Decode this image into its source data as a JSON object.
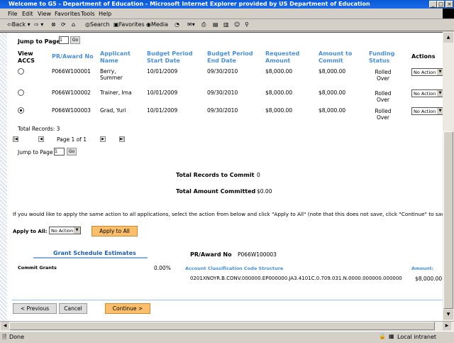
{
  "window": {
    "title": "Welcome to G5 - Department of Education - Microsoft Internet Explorer provided by US Department of Education"
  },
  "menu": [
    "File",
    "Edit",
    "View",
    "Favorites",
    "Tools",
    "Help"
  ],
  "toolbar": {
    "back": "Back",
    "search": "Search",
    "favorites": "Favorites",
    "media": "Media"
  },
  "jump_top": {
    "label": "Jump to Page",
    "value": "1",
    "go": "Go"
  },
  "table": {
    "headers": [
      "View ACCS",
      "PR/Award No",
      "Applicant Name",
      "Budget Period Start Date",
      "Budget Period End Date",
      "Requested Amount",
      "Amount to Commit",
      "Funding Status",
      "Actions"
    ],
    "rows": [
      {
        "selected": false,
        "award": "P066W100001",
        "applicant": "Berry, Summer",
        "start": "10/01/2009",
        "end": "09/30/2010",
        "requested": "$8,000.00",
        "commit": "$8,000.00",
        "status": "Rolled Over",
        "action": "No Action"
      },
      {
        "selected": false,
        "award": "P066W100002",
        "applicant": "Trainer, Ima",
        "start": "10/01/2009",
        "end": "09/30/2010",
        "requested": "$8,000.00",
        "commit": "$8,000.00",
        "status": "Rolled Over",
        "action": "No Action"
      },
      {
        "selected": true,
        "award": "P066W100003",
        "applicant": "Grad, Yuri",
        "start": "10/01/2009",
        "end": "09/30/2010",
        "requested": "$8,000.00",
        "commit": "$8,000.00",
        "status": "Rolled Over",
        "action": "No Action"
      }
    ]
  },
  "total_records": "Total Records: 3",
  "pager": {
    "text": "Page 1 of 1"
  },
  "jump_bottom": {
    "label": "Jump to Page",
    "value": "1",
    "go": "Go"
  },
  "summary": {
    "records_label": "Total Records to Commit",
    "records_value": "0",
    "amount_label": "Total Amount Committed",
    "amount_value": "$0.00"
  },
  "instruction": "If you would like to apply the same action to all applications, select the action from below and click \"Apply to All\" (note that this does not save, click \"Continue\" to save).",
  "apply": {
    "label": "Apply to All:",
    "select": "No Action",
    "button": "Apply to All"
  },
  "estimates": {
    "title": "Grant Schedule Estimates",
    "commit_label": "Commit Grants",
    "commit_pct": "0.00%",
    "award_label": "PR/Award No",
    "award_value": "P066W100003",
    "accs_header": "Account Classification Code Structure",
    "amount_header": "Amount:",
    "code": "0201XNOYR.B.CONV.000000.EP000000.JA3.4101C.0.709.031.N.0000.000000.000000",
    "amount": "$8,000.00"
  },
  "buttons": {
    "previous": "< Previous",
    "cancel": "Cancel",
    "continue": "Continue >"
  },
  "status": {
    "text": "Done",
    "zone": "Local intranet"
  }
}
